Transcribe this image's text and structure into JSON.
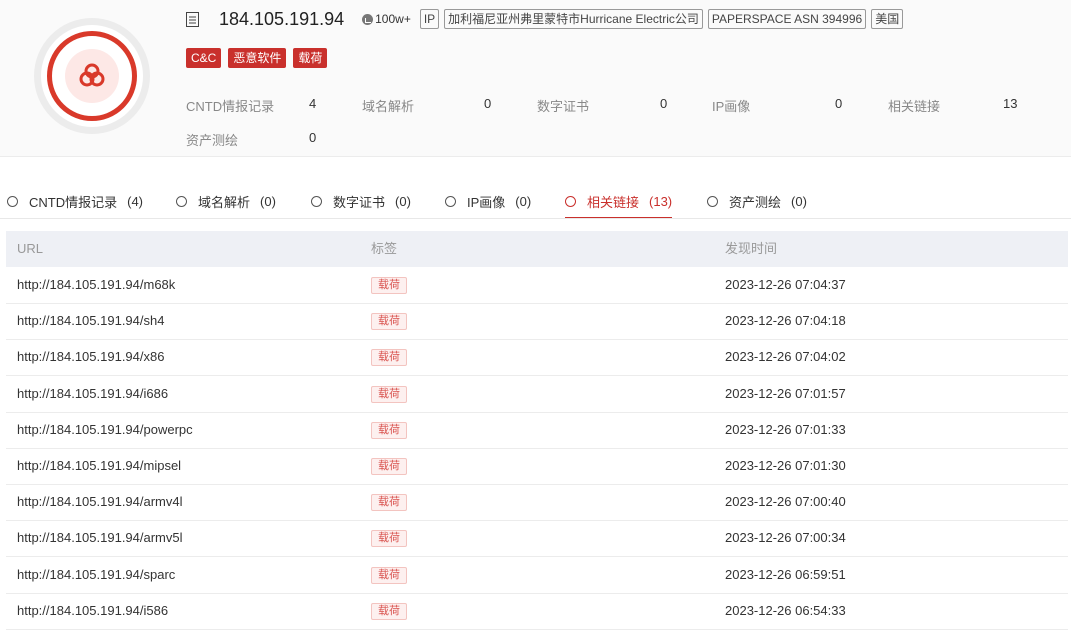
{
  "header": {
    "ip": "184.105.191.94",
    "heat": "100w+",
    "meta_tags": [
      "IP",
      "加利福尼亚州弗里蒙特市Hurricane Electric公司",
      "PAPERSPACE ASN 394996",
      "美国"
    ],
    "threat_tags": [
      "C&C",
      "恶意软件",
      "载荷"
    ],
    "stats": [
      {
        "label": "CNTD情报记录",
        "value": "4"
      },
      {
        "label": "域名解析",
        "value": "0"
      },
      {
        "label": "数字证书",
        "value": "0"
      },
      {
        "label": "IP画像",
        "value": "0"
      },
      {
        "label": "相关链接",
        "value": "13"
      },
      {
        "label": "资产测绘",
        "value": "0"
      }
    ]
  },
  "tabs": [
    {
      "label": "CNTD情报记录",
      "count": "(4)"
    },
    {
      "label": "域名解析",
      "count": "(0)"
    },
    {
      "label": "数字证书",
      "count": "(0)"
    },
    {
      "label": "IP画像",
      "count": "(0)"
    },
    {
      "label": "相关链接",
      "count": "(13)"
    },
    {
      "label": "资产测绘",
      "count": "(0)"
    }
  ],
  "table": {
    "columns": [
      "URL",
      "标签",
      "发现时间"
    ],
    "rows": [
      {
        "url": "http://184.105.191.94/m68k",
        "tag": "载荷",
        "time": "2023-12-26 07:04:37"
      },
      {
        "url": "http://184.105.191.94/sh4",
        "tag": "载荷",
        "time": "2023-12-26 07:04:18"
      },
      {
        "url": "http://184.105.191.94/x86",
        "tag": "载荷",
        "time": "2023-12-26 07:04:02"
      },
      {
        "url": "http://184.105.191.94/i686",
        "tag": "载荷",
        "time": "2023-12-26 07:01:57"
      },
      {
        "url": "http://184.105.191.94/powerpc",
        "tag": "载荷",
        "time": "2023-12-26 07:01:33"
      },
      {
        "url": "http://184.105.191.94/mipsel",
        "tag": "载荷",
        "time": "2023-12-26 07:01:30"
      },
      {
        "url": "http://184.105.191.94/armv4l",
        "tag": "载荷",
        "time": "2023-12-26 07:00:40"
      },
      {
        "url": "http://184.105.191.94/armv5l",
        "tag": "载荷",
        "time": "2023-12-26 07:00:34"
      },
      {
        "url": "http://184.105.191.94/sparc",
        "tag": "载荷",
        "time": "2023-12-26 06:59:51"
      },
      {
        "url": "http://184.105.191.94/i586",
        "tag": "载荷",
        "time": "2023-12-26 06:54:33"
      }
    ]
  },
  "colors": {
    "accent": "#c9302c",
    "ring": "#d9392a"
  }
}
